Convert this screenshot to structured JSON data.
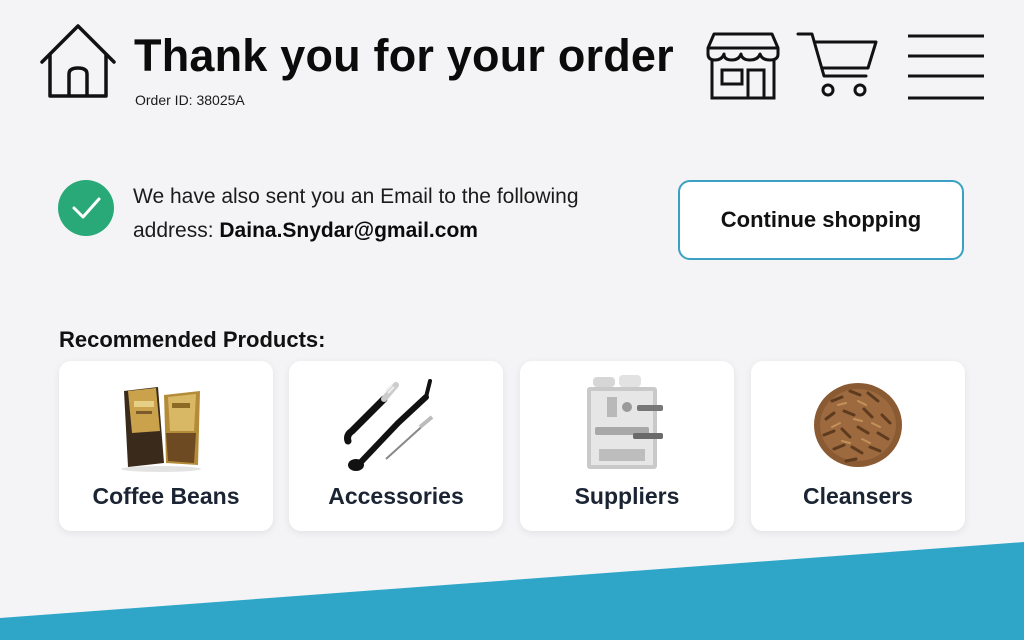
{
  "header": {
    "title": "Thank you for your order",
    "order_id": "Order ID: 38025A",
    "icons": [
      "home-icon",
      "store-icon",
      "shopping-cart-icon",
      "hamburger-menu-icon"
    ]
  },
  "confirmation": {
    "message": "We have also sent you an Email to the following address:",
    "email": "Daina.Snydar@gmail.com",
    "continue_label": "Continue shopping"
  },
  "recommended": {
    "heading": "Recommended Products:",
    "products": [
      {
        "label": "Coffee Beans",
        "icon": "coffee-bag-icon"
      },
      {
        "label": "Accessories",
        "icon": "brush-spoon-icon"
      },
      {
        "label": "Suppliers",
        "icon": "espresso-machine-icon"
      },
      {
        "label": "Cleansers",
        "icon": "pellets-icon"
      }
    ]
  },
  "colors": {
    "background": "#f4f4f6",
    "accent": "#2fa6c8",
    "success": "#2aa978",
    "card": "#ffffff",
    "text": "#111111"
  }
}
